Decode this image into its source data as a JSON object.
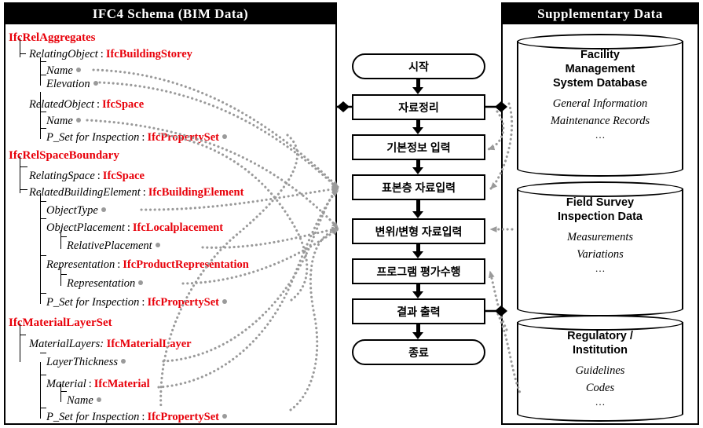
{
  "left_panel": {
    "title": "IFC4 Schema (BIM Data)",
    "nodes": [
      {
        "indent": 0,
        "label": "IfcRelAggregates",
        "kind": "root",
        "dot": false
      },
      {
        "indent": 1,
        "label": "RelatingObject",
        "type": "IfcBuildingStorey",
        "kind": "attr",
        "dot": false
      },
      {
        "indent": 2,
        "label": "Name",
        "type": "",
        "kind": "attr",
        "dot": true
      },
      {
        "indent": 2,
        "label": "Elevation",
        "type": "",
        "kind": "attr",
        "dot": true
      },
      {
        "indent": 1,
        "label": "RelatedObject",
        "type": "IfcSpace",
        "kind": "attr",
        "dot": false
      },
      {
        "indent": 2,
        "label": "Name",
        "type": "",
        "kind": "attr",
        "dot": true
      },
      {
        "indent": 2,
        "label": "P_Set for Inspection",
        "type": "IfcPropertySet",
        "kind": "attr",
        "dot": true
      },
      {
        "indent": 0,
        "label": "IfcRelSpaceBoundary",
        "kind": "root",
        "dot": false
      },
      {
        "indent": 1,
        "label": "RelatingSpace",
        "type": "IfcSpace",
        "kind": "attr",
        "dot": false
      },
      {
        "indent": 1,
        "label": "RelatedBuildingElement",
        "type": "IfcBuildingElement",
        "kind": "attr",
        "dot": false
      },
      {
        "indent": 2,
        "label": "ObjectType",
        "type": "",
        "kind": "attr",
        "dot": true
      },
      {
        "indent": 2,
        "label": "ObjectPlacement",
        "type": "IfcLocalplacement",
        "kind": "attr",
        "dot": false
      },
      {
        "indent": 3,
        "label": "RelativePlacement",
        "type": "",
        "kind": "attr",
        "dot": true
      },
      {
        "indent": 2,
        "label": "Representation",
        "type": "IfcProductRepresentation",
        "kind": "attr",
        "dot": false
      },
      {
        "indent": 3,
        "label": "Representation",
        "type": "",
        "kind": "attr",
        "dot": true
      },
      {
        "indent": 2,
        "label": "P_Set for Inspection",
        "type": "IfcPropertySet",
        "kind": "attr",
        "dot": true
      },
      {
        "indent": 0,
        "label": "IfcMaterialLayerSet",
        "kind": "root",
        "dot": false
      },
      {
        "indent": 1,
        "label": "MaterialLayers:",
        "type": "IfcMaterialLayer",
        "kind": "attr_nocolon",
        "dot": false
      },
      {
        "indent": 2,
        "label": "LayerThickness",
        "type": "",
        "kind": "attr",
        "dot": true
      },
      {
        "indent": 2,
        "label": "Material",
        "type": "IfcMaterial",
        "kind": "attr",
        "dot": false
      },
      {
        "indent": 3,
        "label": "Name",
        "type": "",
        "kind": "attr",
        "dot": true
      },
      {
        "indent": 2,
        "label": "P_Set for Inspection",
        "type": "IfcPropertySet",
        "kind": "attr",
        "dot": true
      }
    ]
  },
  "flow": {
    "steps": [
      {
        "label": "시작",
        "shape": "terminator"
      },
      {
        "label": "자료정리",
        "shape": "process"
      },
      {
        "label": "기본정보 입력",
        "shape": "process"
      },
      {
        "label": "표본층 자료입력",
        "shape": "process"
      },
      {
        "label": "변위/변형 자료입력",
        "shape": "process"
      },
      {
        "label": "프로그램 평가수행",
        "shape": "process"
      },
      {
        "label": "결과 출력",
        "shape": "process"
      },
      {
        "label": "종료",
        "shape": "terminator"
      }
    ]
  },
  "right_panel": {
    "title": "Supplementary  Data",
    "databases": [
      {
        "heading": [
          "Facility",
          "Management",
          "System Database"
        ],
        "items": [
          "General Information",
          "Maintenance Records"
        ],
        "ellipsis": "…"
      },
      {
        "heading": [
          "Field Survey",
          "Inspection Data"
        ],
        "items": [
          "Measurements",
          "Variations"
        ],
        "ellipsis": "…"
      },
      {
        "heading": [
          "Regulatory /",
          "Institution"
        ],
        "items": [
          "Guidelines",
          "Codes"
        ],
        "ellipsis": "…"
      }
    ]
  },
  "colors": {
    "entity_red": "#e8000a",
    "link_gray": "#9a9a9a",
    "title_bar": "#000000"
  },
  "separator": ":"
}
